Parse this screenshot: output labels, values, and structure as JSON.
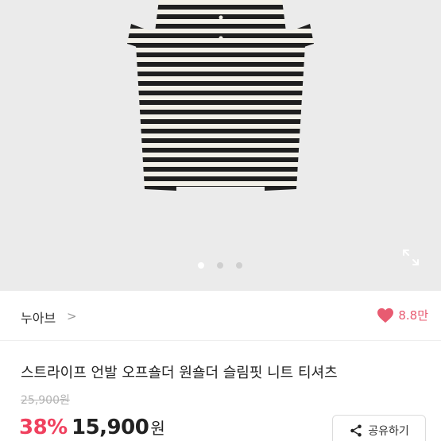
{
  "gallery": {
    "slide_count": 3,
    "active_index": 0,
    "expand_icon": "expand-icon",
    "stripe_colors": [
      "#1f1f1f",
      "#f2f0e8"
    ]
  },
  "shop": {
    "name": "누아브",
    "chevron": ">",
    "likes": "8.8만",
    "like_color": "#e85b71"
  },
  "product": {
    "title": "스트라이프 언발 오프숄더 원숄더 슬림핏 니트 티셔츠",
    "original_price": "25,900원",
    "discount": "38%",
    "price": "15,900",
    "currency": "원",
    "discount_color": "#f0415f"
  },
  "actions": {
    "share_label": "공유하기",
    "share_icon": "share-icon"
  }
}
